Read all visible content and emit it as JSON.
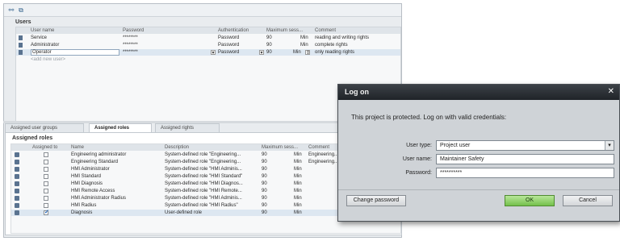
{
  "users": {
    "title": "Users",
    "columns": [
      "User name",
      "Password",
      "Authentication",
      "Maximum sess...",
      "Comment"
    ],
    "rows": [
      {
        "name": "Service",
        "password": "********",
        "auth": "Password",
        "max": "90",
        "unit": "Min",
        "comment": "reading and writing rights"
      },
      {
        "name": "Administrator",
        "password": "********",
        "auth": "Password",
        "max": "90",
        "unit": "Min",
        "comment": "complete rights"
      },
      {
        "name": "Operator",
        "password": "********",
        "auth": "Password",
        "max": "90",
        "unit": "Min",
        "comment": "only reading rights"
      }
    ],
    "add_new": "<add new user>"
  },
  "tabs": [
    "Assigned user groups",
    "Assigned roles",
    "Assigned rights"
  ],
  "roles": {
    "title": "Assigned roles",
    "columns": [
      "Assigned to",
      "Name",
      "Description",
      "Maximum sess...",
      "Comment"
    ],
    "rows": [
      {
        "checked": false,
        "name": "Engineering administrator",
        "desc": "System-defined role \"Engineering...",
        "max": "90",
        "unit": "Min",
        "comment": "Engineering..."
      },
      {
        "checked": false,
        "name": "Engineering Standard",
        "desc": "System-defined role \"Engineering...",
        "max": "90",
        "unit": "Min",
        "comment": "Engineering..."
      },
      {
        "checked": false,
        "name": "HMI Administrator",
        "desc": "System-defined role \"HMI Adminis...",
        "max": "90",
        "unit": "Min",
        "comment": ""
      },
      {
        "checked": false,
        "name": "HMI Standard",
        "desc": "System-defined role \"HMI Standard\"",
        "max": "90",
        "unit": "Min",
        "comment": ""
      },
      {
        "checked": false,
        "name": "HMI Diagnosis",
        "desc": "System-defined role \"HMI Diagnos...",
        "max": "90",
        "unit": "Min",
        "comment": ""
      },
      {
        "checked": false,
        "name": "HMI Remote Access",
        "desc": "System-defined role \"HMI Remote...",
        "max": "90",
        "unit": "Min",
        "comment": ""
      },
      {
        "checked": false,
        "name": "HMI Administrator Radius",
        "desc": "System-defined role \"HMI Adminis...",
        "max": "90",
        "unit": "Min",
        "comment": ""
      },
      {
        "checked": false,
        "name": "HMI Radius",
        "desc": "System-defined role \"HMI Radius\"",
        "max": "90",
        "unit": "Min",
        "comment": ""
      },
      {
        "checked": true,
        "name": "Diagnosis",
        "desc": "User-defined role",
        "max": "90",
        "unit": "Min",
        "comment": ""
      }
    ]
  },
  "dialog": {
    "title": "Log on",
    "message": "This project is protected. Log on with valid credentials:",
    "user_type_label": "User type:",
    "user_type_value": "Project user",
    "user_name_label": "User name:",
    "user_name_value": "Maintainer Safety",
    "password_label": "Password:",
    "password_value": "**********",
    "change_password": "Change password",
    "ok": "OK",
    "cancel": "Cancel"
  },
  "colors": {
    "ok_button": "#74c04b",
    "titlebar": "#1f2328",
    "row_icon": "#5a7390"
  }
}
